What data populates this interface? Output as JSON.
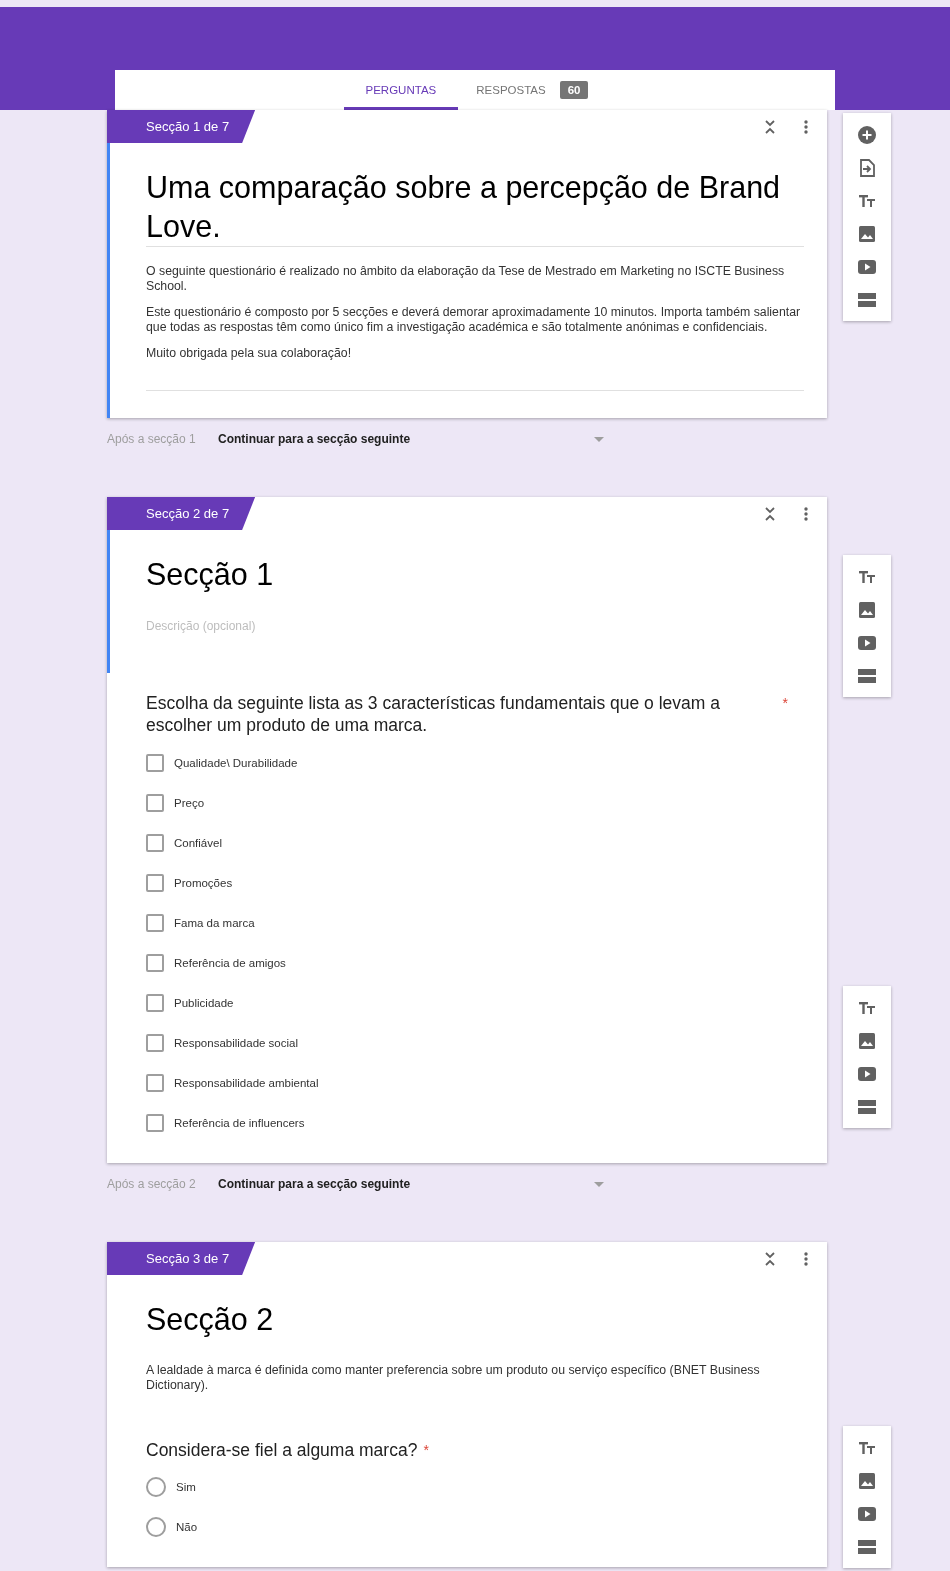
{
  "tabs": [
    {
      "label": "PERGUNTAS",
      "selected": true
    },
    {
      "label": "RESPOSTAS",
      "selected": false,
      "badge": "60"
    }
  ],
  "sections": [
    {
      "tag": "Secção 1 de 7",
      "selected": true,
      "editing": true,
      "title": "Uma comparação sobre a percepção de Brand Love.",
      "description": [
        "O seguinte questionário é realizado no âmbito da elaboração da Tese de Mestrado em Marketing no ISCTE Business School.",
        "Este questionário é composto por 5 secções e deverá demorar aproximadamente 10 minutos. Importa também salientar que todas as respostas têm como único fim a investigação académica e são totalmente anónimas e confidenciais.",
        "Muito obrigada pela sua colaboração!"
      ],
      "after": {
        "label": "Após a secção 1",
        "value": "Continuar para a secção seguinte"
      },
      "toolbars": [
        {
          "tools": [
            {
              "kind": "add"
            },
            {
              "kind": "import"
            },
            {
              "kind": "title"
            },
            {
              "kind": "image"
            },
            {
              "kind": "video"
            },
            {
              "kind": "section"
            }
          ]
        }
      ]
    },
    {
      "tag": "Secção 2 de 7",
      "selected": true,
      "editing": false,
      "title": "Secção 1",
      "placeholder": "Descrição (opcional)",
      "questions": [
        {
          "kind": "checkbox",
          "text": "Escolha da seguinte lista as 3 características fundamentais que o levam a escolher um produto de uma marca.",
          "required_mark": "*",
          "options": [
            {
              "label": "Qualidade\\ Durabilidade",
              "checked": false
            },
            {
              "label": "Preço",
              "checked": false
            },
            {
              "label": "Confiável",
              "checked": false
            },
            {
              "label": "Promoções",
              "checked": false
            },
            {
              "label": "Fama da marca",
              "checked": false
            },
            {
              "label": "Referência de amigos",
              "checked": false
            },
            {
              "label": "Publicidade",
              "checked": false
            },
            {
              "label": "Responsabilidade social",
              "checked": false
            },
            {
              "label": "Responsabilidade ambiental",
              "checked": false
            },
            {
              "label": "Referência de influencers",
              "checked": false
            }
          ]
        }
      ],
      "after": {
        "label": "Após a secção 2",
        "value": "Continuar para a secção seguinte"
      },
      "toolbars": [
        {
          "tools": [
            {
              "kind": "title"
            },
            {
              "kind": "image"
            },
            {
              "kind": "video"
            },
            {
              "kind": "section"
            }
          ]
        },
        {
          "tools": [
            {
              "kind": "title"
            },
            {
              "kind": "image"
            },
            {
              "kind": "video"
            },
            {
              "kind": "section"
            }
          ]
        }
      ]
    },
    {
      "tag": "Secção 3 de 7",
      "selected": false,
      "editing": false,
      "title": "Secção 2",
      "description": [
        "A lealdade à marca é definida como manter preferencia sobre um produto ou serviço específico (BNET Business Dictionary)."
      ],
      "questions": [
        {
          "kind": "radio",
          "text": "Considera-se fiel a alguma marca?",
          "required_mark": "*",
          "options": [
            {
              "label": "Sim",
              "selected": false
            },
            {
              "label": "Não",
              "selected": false
            }
          ]
        }
      ],
      "toolbars": [
        {
          "tools": [
            {
              "kind": "title"
            },
            {
              "kind": "image"
            },
            {
              "kind": "video"
            },
            {
              "kind": "section"
            }
          ]
        }
      ]
    }
  ]
}
